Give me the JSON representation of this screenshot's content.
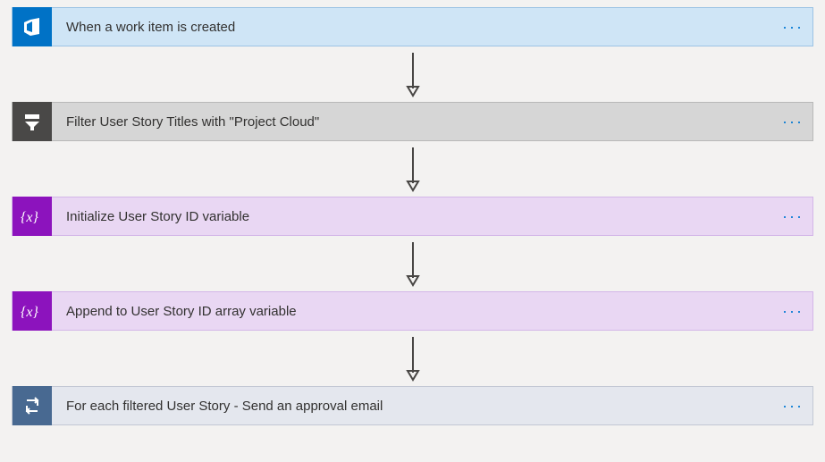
{
  "steps": [
    {
      "title": "When a work item is created",
      "icon": "azure-devops-icon",
      "iconBg": "icon-azure",
      "rowBg": "bg-blue-light"
    },
    {
      "title": "Filter User Story Titles with \"Project Cloud\"",
      "icon": "filter-array-icon",
      "iconBg": "icon-gray",
      "rowBg": "bg-gray"
    },
    {
      "title": "Initialize User Story ID variable",
      "icon": "variable-icon",
      "iconBg": "icon-purple",
      "rowBg": "bg-purple-light"
    },
    {
      "title": "Append to User Story ID array variable",
      "icon": "variable-icon",
      "iconBg": "icon-purple",
      "rowBg": "bg-purple-light"
    },
    {
      "title": "For each filtered User Story - Send an approval email",
      "icon": "loop-icon",
      "iconBg": "icon-slate",
      "rowBg": "bg-slate"
    }
  ],
  "menuGlyph": "···"
}
